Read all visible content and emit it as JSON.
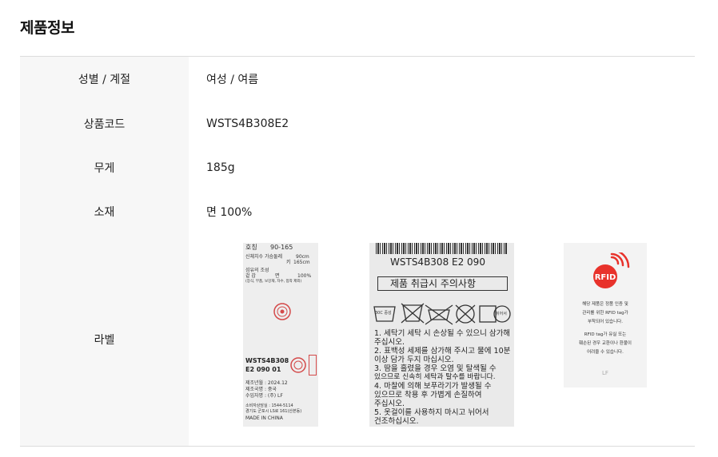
{
  "section_title": "제품정보",
  "rows": [
    {
      "label": "성별 / 계절",
      "value": "여성 / 여름"
    },
    {
      "label": "상품코드",
      "value": "WSTS4B308E2"
    },
    {
      "label": "무게",
      "value": "185g"
    },
    {
      "label": "소재",
      "value": "면 100%"
    }
  ],
  "label_row_title": "라벨",
  "label1": {
    "size_head": "호칭",
    "size_val": "90-165",
    "chest_head": "신체치수 가슴둘레",
    "chest_val": "90cm",
    "height_head": "키",
    "height_val": "165cm",
    "fiber_head": "섬유의 조성",
    "fiber_part": "겉 감",
    "fiber_mat": "면",
    "fiber_pct": "100%",
    "fiber_note": "(장식, 부품, 보강재, 자수, 접착 제외)",
    "code": "WSTS4B308",
    "code2": "E2 090 01",
    "made_date": "제조년월 : 2024.12",
    "made_country": "제조국명 : 중국",
    "importer": "수입자명 : (주) LF",
    "consult": "소비자상담실 : 1544-5114",
    "address": "경기도 군포시 LS로 161(산본동)",
    "made_in": "MADE IN CHINA"
  },
  "label2": {
    "code": "WSTS4B308 E2 090",
    "heading": "제품 취급시 주의사항",
    "care1": "30C 중성",
    "care5": "뒤어서",
    "items": [
      "1. 세탁기 세탁 시 손상될 수 있으니 삼가해",
      "    주십시오.",
      "2. 표백성 세제를 삼가해 주시고 물에 10분",
      "    이상 담가 두지 마십시오.",
      "3. 땀을 흘렸을 경우 오염 및 탈색될 수",
      "    있으므로 신속히 세탁과 탈수를 바랍니다.",
      "4. 마찰에 의해 보푸라기가 발생될 수",
      "    있으므로 착용 후 가볍게 손질하여",
      "    주십시오.",
      "5. 옷걸이를 사용하지 마시고 뉘어서",
      "    건조하십시오."
    ]
  },
  "label3": {
    "rfid": "RFID",
    "line1": "해당 제품은 정품 인증 및",
    "line2": "관리를 위한 RFID tag가",
    "line3": "부착되어 있습니다.",
    "line4": "RFID tag가 유실 또는",
    "line5": "훼손된 경우 교환이나 환불이",
    "line6": "어려울 수 있습니다.",
    "brand": "LF"
  },
  "colors": {
    "header_bg": "#f7f7f7",
    "border": "#dcdcdc",
    "rfid_red": "#e8322b"
  }
}
